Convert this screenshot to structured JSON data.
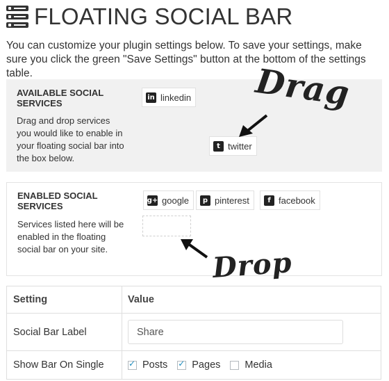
{
  "header": {
    "title": "FLOATING SOCIAL BAR",
    "logo_icon": "stacked-bars-icon"
  },
  "intro": "You can customize your plugin settings below. To save your settings, make sure you click the green \"Save Settings\" button at the bottom of the settings table.",
  "available": {
    "heading": "AVAILABLE SOCIAL SERVICES",
    "description": "Drag and drop services you would like to enable in your floating social bar into the box below.",
    "services": [
      {
        "label": "linkedin",
        "icon": "linkedin-icon",
        "glyph": "in"
      },
      {
        "label": "twitter",
        "icon": "twitter-icon",
        "glyph": "t"
      }
    ]
  },
  "enabled": {
    "heading": "ENABLED SOCIAL SERVICES",
    "description": "Services listed here will be enabled in the floating social bar on your site.",
    "services": [
      {
        "label": "google",
        "icon": "google-plus-icon",
        "glyph": "g+"
      },
      {
        "label": "pinterest",
        "icon": "pinterest-icon",
        "glyph": "p"
      },
      {
        "label": "facebook",
        "icon": "facebook-icon",
        "glyph": "f"
      }
    ]
  },
  "annotations": {
    "drag": "Drag",
    "drop": "Drop"
  },
  "settings": {
    "col_setting": "Setting",
    "col_value": "Value",
    "label_row": {
      "label": "Social Bar Label",
      "value": "Share"
    },
    "single_row": {
      "label": "Show Bar On Single",
      "options": [
        {
          "label": "Posts",
          "checked": true
        },
        {
          "label": "Pages",
          "checked": true
        },
        {
          "label": "Media",
          "checked": false
        }
      ]
    }
  }
}
